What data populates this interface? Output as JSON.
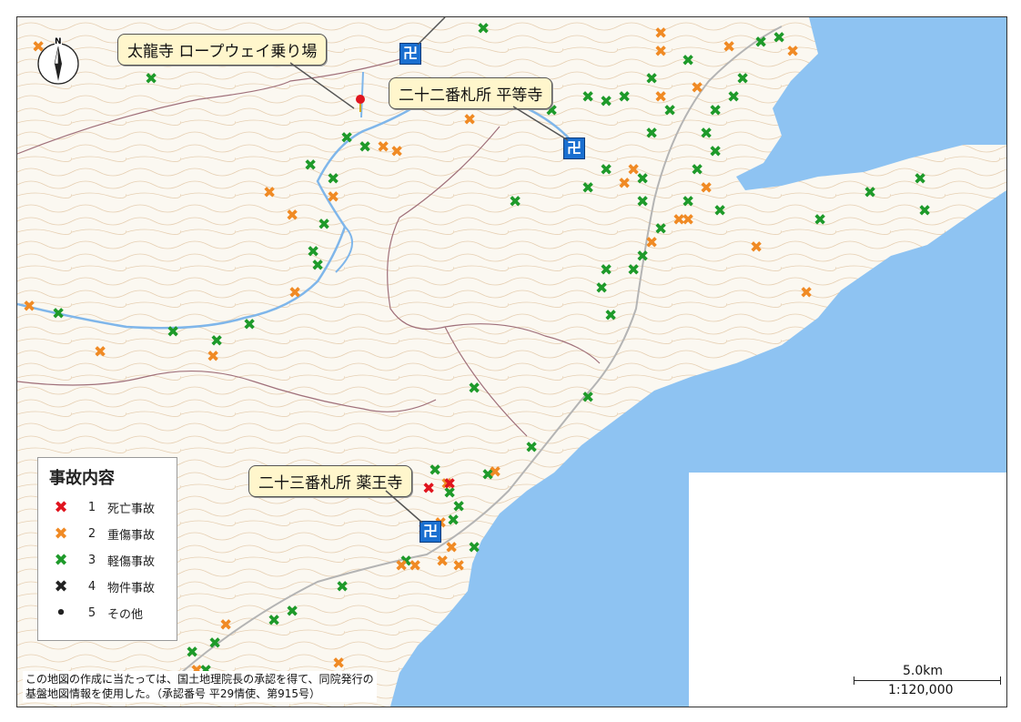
{
  "callouts": [
    {
      "label": "太龍寺 ロープウェイ乗り場"
    },
    {
      "label": "二十二番札所 平等寺"
    },
    {
      "label": "二十三番札所 薬王寺"
    }
  ],
  "legend": {
    "title": "事故内容",
    "items": [
      {
        "num": "1",
        "label": "死亡事故",
        "color": "#e0141e",
        "glyph": "✖"
      },
      {
        "num": "2",
        "label": "重傷事故",
        "color": "#f08a24",
        "glyph": "✖"
      },
      {
        "num": "3",
        "label": "軽傷事故",
        "color": "#1e9a2a",
        "glyph": "✖"
      },
      {
        "num": "4",
        "label": "物件事故",
        "color": "#222222",
        "glyph": "✖"
      },
      {
        "num": "5",
        "label": "その他",
        "color": "#222222",
        "glyph": "•"
      }
    ]
  },
  "credit": {
    "line1": "この地図の作成に当たっては、国土地理院長の承認を得て、同院発行の",
    "line2": "基盤地図情報を使用した。（承認番号 平29情使、第915号）"
  },
  "scale": {
    "length": "5.0km",
    "ratio": "1:120,000"
  },
  "north_label": "N",
  "colors": {
    "sea": "#8ec3f2",
    "land": "#fbf8f1",
    "contour": "#e2c8a8",
    "river": "#7fb6ea",
    "boundary": "#a0707a",
    "road": "#b4b4b4"
  }
}
